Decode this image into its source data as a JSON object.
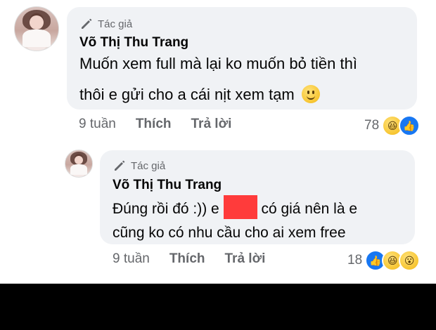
{
  "comments": [
    {
      "badge": "Tác giả",
      "author": "Võ Thị Thu Trang",
      "line1": "Muốn xem full mà lại ko muốn bỏ tiền thì",
      "line2": "thôi e gửi cho a cái nịt xem tạm",
      "time": "9 tuần",
      "like_label": "Thích",
      "reply_label": "Trả lời",
      "reaction_count": "78",
      "reactions": [
        "haha-icon",
        "like-icon"
      ]
    },
    {
      "badge": "Tác giả",
      "author": "Võ Thị Thu Trang",
      "line1_before": "Đúng rồi đó :)) e",
      "line1_after": "có giá nên là e",
      "line2": "cũng ko có nhu cầu cho ai xem free",
      "time": "9 tuần",
      "like_label": "Thích",
      "reply_label": "Trả lời",
      "reaction_count": "18",
      "reactions": [
        "like-icon",
        "haha-icon",
        "wow-icon"
      ]
    }
  ],
  "colors": {
    "bubble": "#f0f2f5",
    "meta": "#65676b",
    "like": "#1877f2",
    "redaction": "#ff3b3b"
  }
}
